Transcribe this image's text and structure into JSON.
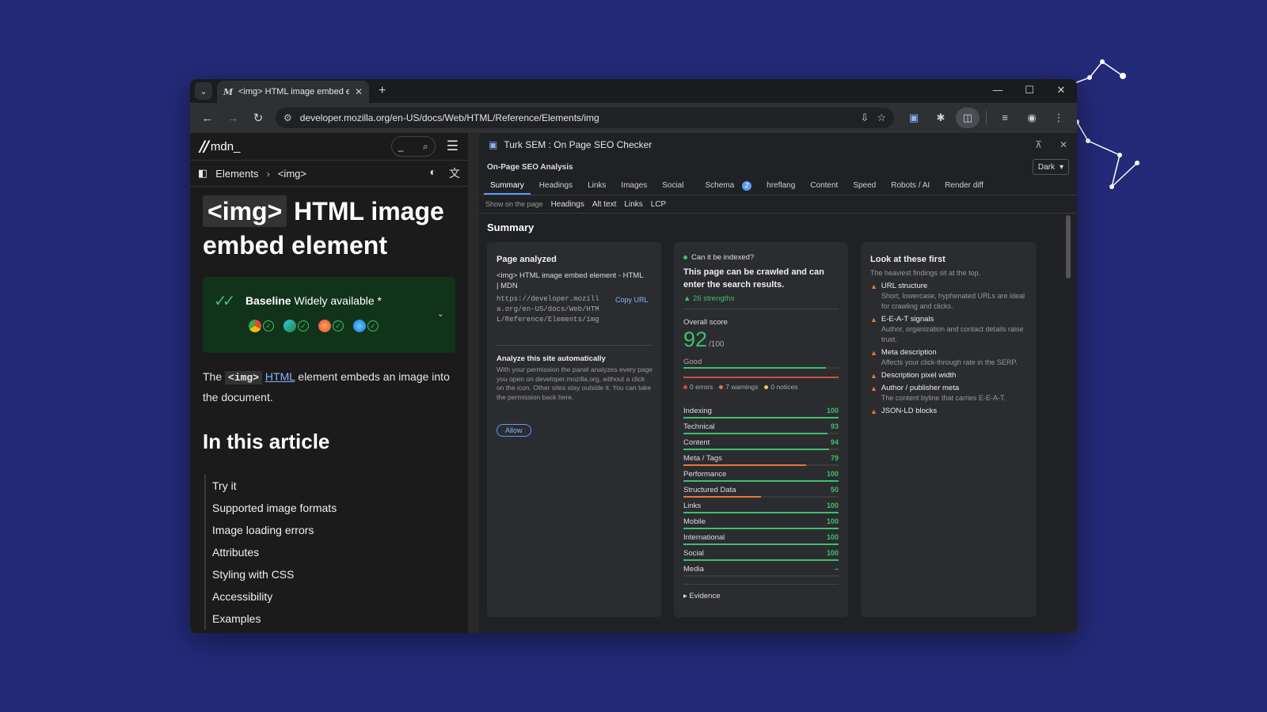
{
  "tab": {
    "title": "<img> HTML image embed ele",
    "favicon": "M"
  },
  "address_bar": {
    "url": "developer.mozilla.org/en-US/docs/Web/HTML/Reference/Elements/img"
  },
  "mdn": {
    "logo": "mdn_",
    "search_glyph": "_",
    "breadcrumb": [
      "Elements",
      "<img>"
    ],
    "heading_code": "<img>",
    "heading_text": "HTML image embed element",
    "baseline_bold": "Baseline",
    "baseline_text": "Widely available *",
    "intro_pre": "The",
    "intro_code": "<img>",
    "intro_link": "HTML",
    "intro_post": "element embeds an image into the document.",
    "toc_heading": "In this article",
    "toc": [
      "Try it",
      "Supported image formats",
      "Image loading errors",
      "Attributes",
      "Styling with CSS",
      "Accessibility",
      "Examples"
    ]
  },
  "panel": {
    "title": "Turk SEM : On Page SEO Checker",
    "subtitle": "On-Page SEO Analysis",
    "theme": "Dark",
    "tabs": [
      "Summary",
      "Headings",
      "Links",
      "Images",
      "Social",
      "Schema",
      "hreflang",
      "Content",
      "Speed",
      "Robots / AI",
      "Render diff"
    ],
    "schema_badge": "2",
    "show_on_label": "Show on the page",
    "show_on": [
      "Headings",
      "Alt text",
      "Links",
      "LCP"
    ],
    "section_title": "Summary",
    "page_analyzed": {
      "title": "Page analyzed",
      "page_title": "<img> HTML image embed element - HTML | MDN",
      "url": "https://developer.mozilla.org/en-US/docs/Web/HTML/Reference/Elements/img",
      "copy": "Copy URL",
      "auto_title": "Analyze this site automatically",
      "auto_desc": "With your permission the panel analyzes every page you open on developer.mozilla.org, without a click on the icon. Other sites stay outside it. You can take the permission back here.",
      "allow": "Allow"
    },
    "index": {
      "question": "Can it be indexed?",
      "answer": "This page can be crawled and can enter the search results.",
      "strengths": "▲ 26 strengths",
      "overall_label": "Overall score",
      "score": "92",
      "score_max": "/100",
      "rating": "Good",
      "score_fraction": 0.92,
      "errors": "0 errors",
      "warnings": "7 warnings",
      "notices": "0 notices",
      "categories": [
        {
          "name": "Indexing",
          "value": "100",
          "fill": 1.0,
          "color": "#3ec06a"
        },
        {
          "name": "Technical",
          "value": "93",
          "fill": 0.93,
          "color": "#3ec06a"
        },
        {
          "name": "Content",
          "value": "94",
          "fill": 0.94,
          "color": "#3ec06a"
        },
        {
          "name": "Meta / Tags",
          "value": "79",
          "fill": 0.79,
          "color": "#e8763d"
        },
        {
          "name": "Performance",
          "value": "100",
          "fill": 1.0,
          "color": "#3ec06a"
        },
        {
          "name": "Structured Data",
          "value": "50",
          "fill": 0.5,
          "color": "#e8763d"
        },
        {
          "name": "Links",
          "value": "100",
          "fill": 1.0,
          "color": "#3ec06a"
        },
        {
          "name": "Mobile",
          "value": "100",
          "fill": 1.0,
          "color": "#3ec06a"
        },
        {
          "name": "International",
          "value": "100",
          "fill": 1.0,
          "color": "#3ec06a"
        },
        {
          "name": "Social",
          "value": "100",
          "fill": 1.0,
          "color": "#3ec06a"
        },
        {
          "name": "Media",
          "value": "–",
          "fill": 0,
          "color": "#3ec06a"
        }
      ],
      "evidence": "Evidence"
    },
    "look_first": {
      "title": "Look at these first",
      "subtitle": "The heaviest findings sit at the top.",
      "items": [
        {
          "title": "URL structure",
          "desc": "Short, lowercase, hyphenated URLs are ideal for crawling and clicks."
        },
        {
          "title": "E-E-A-T signals",
          "desc": "Author, organization and contact details raise trust."
        },
        {
          "title": "Meta description",
          "desc": "Affects your click-through rate in the SERP."
        },
        {
          "title": "Description pixel width",
          "desc": ""
        },
        {
          "title": "Author / publisher meta",
          "desc": "The content byline that carries E-E-A-T."
        },
        {
          "title": "JSON-LD blocks",
          "desc": ""
        }
      ]
    }
  }
}
